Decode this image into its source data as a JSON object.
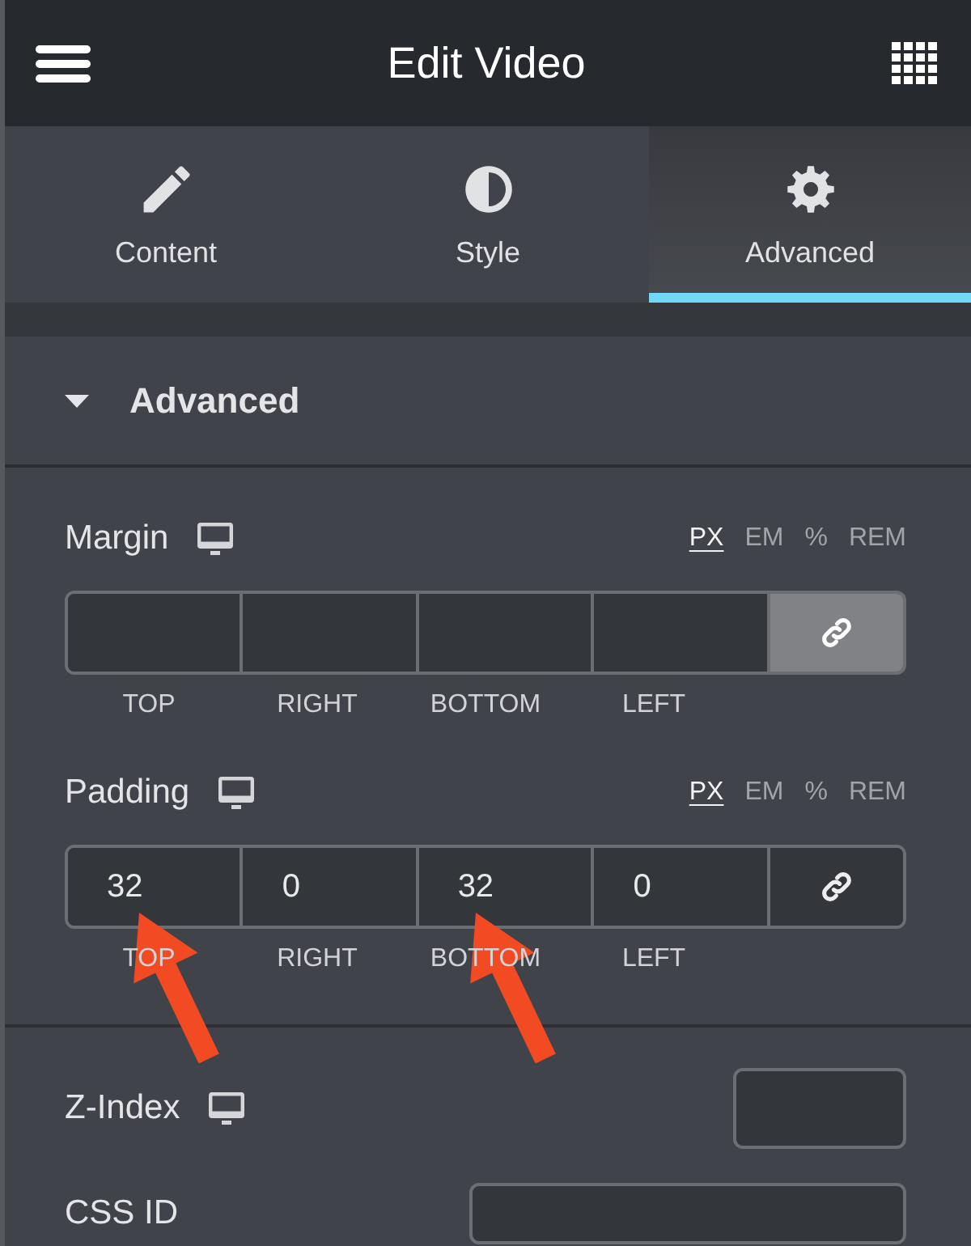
{
  "header": {
    "title": "Edit Video"
  },
  "tabs": [
    {
      "label": "Content",
      "selected": false
    },
    {
      "label": "Style",
      "selected": false
    },
    {
      "label": "Advanced",
      "selected": true
    }
  ],
  "section": {
    "title": "Advanced",
    "expanded": true
  },
  "dimension_controls": [
    {
      "label": "Margin",
      "responsive": true,
      "units": [
        {
          "label": "PX",
          "selected": true
        },
        {
          "label": "EM",
          "selected": false
        },
        {
          "label": "%",
          "selected": false
        },
        {
          "label": "REM",
          "selected": false
        }
      ],
      "fields": [
        {
          "side": "TOP",
          "arrow": false
        },
        {
          "side": "RIGHT",
          "arrow": false
        },
        {
          "side": "BOTTOM",
          "arrow": false
        },
        {
          "side": "LEFT",
          "arrow": false
        }
      ],
      "linked": true
    },
    {
      "label": "Padding",
      "responsive": true,
      "units": [
        {
          "label": "PX",
          "selected": true
        },
        {
          "label": "EM",
          "selected": false
        },
        {
          "label": "%",
          "selected": false
        },
        {
          "label": "REM",
          "selected": false
        }
      ],
      "fields": [
        {
          "side": "TOP",
          "value": "32",
          "arrow": true
        },
        {
          "side": "RIGHT",
          "value": "0",
          "arrow": false
        },
        {
          "side": "BOTTOM",
          "value": "32",
          "arrow": true
        },
        {
          "side": "LEFT",
          "value": "0",
          "arrow": false
        }
      ],
      "linked": false
    }
  ],
  "settings": [
    {
      "label": "Z-Index",
      "kind": "number",
      "responsive": true
    },
    {
      "label": "CSS ID",
      "kind": "text",
      "responsive": false
    }
  ]
}
